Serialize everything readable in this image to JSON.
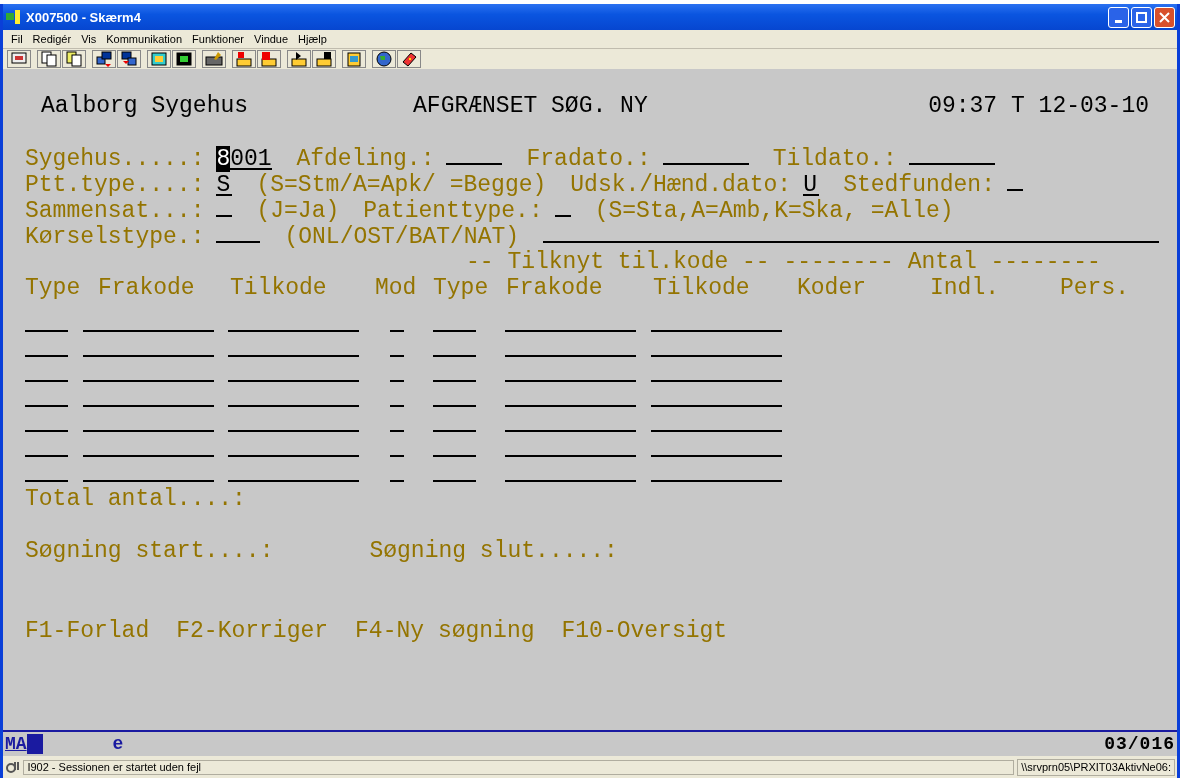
{
  "window": {
    "title": "X007500 - Skærm4"
  },
  "menu": [
    "Fil",
    "Redigér",
    "Vis",
    "Kommunikation",
    "Funktioner",
    "Vindue",
    "Hjælp"
  ],
  "screen": {
    "header": {
      "system": "Aalborg Sygehus",
      "title": "AFGRÆNSET SØG. NY",
      "datetime": "09:37 T 12-03-10"
    },
    "form_rows": [
      {
        "items": [
          {
            "kind": "label",
            "text": "Sygehus.....:"
          },
          {
            "kind": "codefield",
            "value": "8001",
            "focused": true
          },
          {
            "kind": "label",
            "text": "Afdeling.:"
          },
          {
            "kind": "codefield"
          },
          {
            "kind": "label",
            "text": "Fradato.:"
          },
          {
            "kind": "datefield"
          },
          {
            "kind": "label",
            "text": "Tildato.:"
          },
          {
            "kind": "datefield"
          }
        ]
      },
      {
        "items": [
          {
            "kind": "label",
            "text": "Ptt.type....:"
          },
          {
            "kind": "flagfield",
            "value": "S",
            "focused": false
          },
          {
            "kind": "hint",
            "text": "(S=Stm/A=Apk/ =Begge)"
          },
          {
            "kind": "label",
            "text": "Udsk./Hænd.dato:"
          },
          {
            "kind": "flagfield",
            "value": "U",
            "focused": false
          },
          {
            "kind": "label",
            "text": "Stedfunden:"
          },
          {
            "kind": "flagfield"
          }
        ]
      },
      {
        "items": [
          {
            "kind": "label",
            "text": "Sammensat...:"
          },
          {
            "kind": "flagfield"
          },
          {
            "kind": "hint",
            "text": "(J=Ja)"
          },
          {
            "kind": "label",
            "text": "Patienttype.:"
          },
          {
            "kind": "flagfield"
          },
          {
            "kind": "hint",
            "text": "(S=Sta,A=Amb,K=Ska, =Alle)"
          }
        ]
      },
      {
        "items": [
          {
            "kind": "label",
            "text": "Kørselstype.:"
          },
          {
            "kind": "typefield"
          },
          {
            "kind": "hint",
            "text": "(ONL/OST/BAT/NAT)"
          },
          {
            "kind": "linefield"
          }
        ]
      }
    ],
    "group_heading": "-- Tilknyt til.kode -- -------- Antal --------",
    "columns": [
      "Type",
      "Frakode",
      "Tilkode",
      "Mod",
      "Type",
      "Frakode",
      "Tilkode",
      "Koder",
      "Indl.",
      "Pers."
    ],
    "entry_rows": [
      {
        "fields": [
          {
            "kind": "type"
          },
          {
            "kind": "code"
          },
          {
            "kind": "code"
          },
          {
            "kind": "mod"
          },
          {
            "kind": "type"
          },
          {
            "kind": "code"
          },
          {
            "kind": "code"
          }
        ]
      },
      {
        "fields": [
          {
            "kind": "type"
          },
          {
            "kind": "code"
          },
          {
            "kind": "code"
          },
          {
            "kind": "mod"
          },
          {
            "kind": "type"
          },
          {
            "kind": "code"
          },
          {
            "kind": "code"
          }
        ]
      },
      {
        "fields": [
          {
            "kind": "type"
          },
          {
            "kind": "code"
          },
          {
            "kind": "code"
          },
          {
            "kind": "mod"
          },
          {
            "kind": "type"
          },
          {
            "kind": "code"
          },
          {
            "kind": "code"
          }
        ]
      },
      {
        "fields": [
          {
            "kind": "type"
          },
          {
            "kind": "code"
          },
          {
            "kind": "code"
          },
          {
            "kind": "mod"
          },
          {
            "kind": "type"
          },
          {
            "kind": "code"
          },
          {
            "kind": "code"
          }
        ]
      },
      {
        "fields": [
          {
            "kind": "type"
          },
          {
            "kind": "code"
          },
          {
            "kind": "code"
          },
          {
            "kind": "mod"
          },
          {
            "kind": "type"
          },
          {
            "kind": "code"
          },
          {
            "kind": "code"
          }
        ]
      },
      {
        "fields": [
          {
            "kind": "type"
          },
          {
            "kind": "code"
          },
          {
            "kind": "code"
          },
          {
            "kind": "mod"
          },
          {
            "kind": "type"
          },
          {
            "kind": "code"
          },
          {
            "kind": "code"
          }
        ]
      },
      {
        "fields": [
          {
            "kind": "type"
          },
          {
            "kind": "code"
          },
          {
            "kind": "code"
          },
          {
            "kind": "mod"
          },
          {
            "kind": "type"
          },
          {
            "kind": "code"
          },
          {
            "kind": "code"
          }
        ]
      }
    ],
    "total_label": "Total antal....:",
    "search_start_label": "Søgning start....:",
    "search_end_label": "Søgning slut.....:",
    "function_keys": [
      "F1-Forlad",
      "F2-Korriger",
      "F4-Ny søgning",
      "F10-Oversigt"
    ]
  },
  "operator_line": {
    "mode": "MA",
    "indicator": "e",
    "cursor_position": "03/016"
  },
  "status_bar": {
    "message": "I902 - Sessionen er startet uden fejl",
    "printer": "\\\\srvprn05\\PRXIT03AktivNe06:"
  }
}
